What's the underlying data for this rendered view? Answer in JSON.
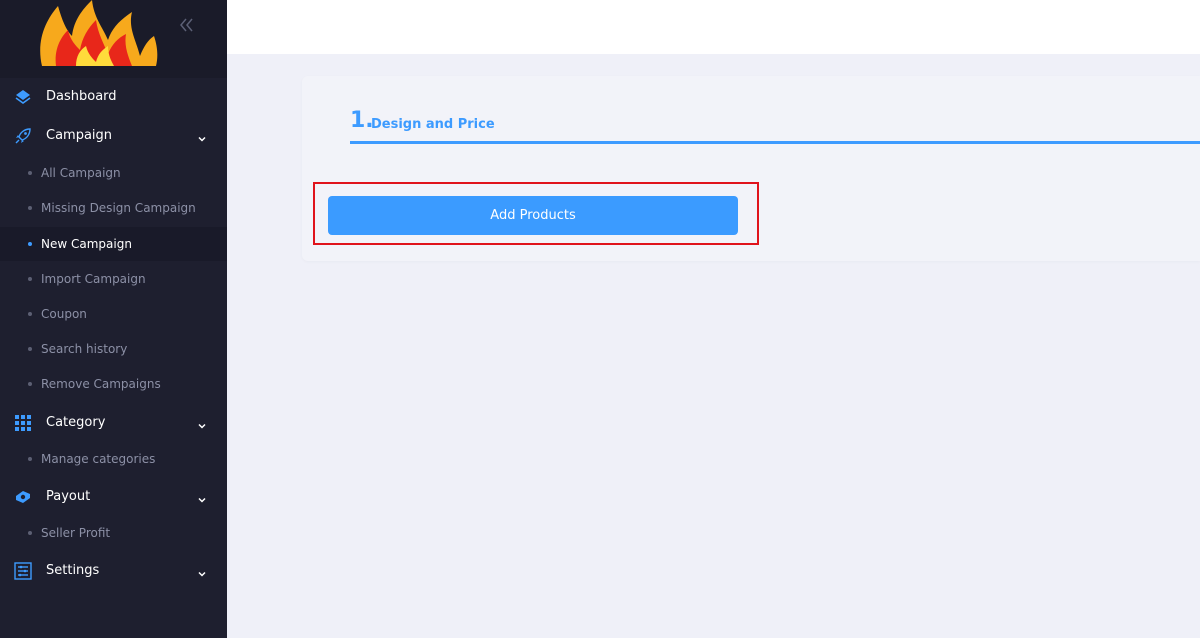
{
  "sidebar": {
    "items": [
      {
        "label": "Dashboard",
        "icon": "layers-icon"
      },
      {
        "label": "Campaign",
        "icon": "rocket-icon"
      },
      {
        "label": "Category",
        "icon": "grid-icon"
      },
      {
        "label": "Payout",
        "icon": "payout-icon"
      },
      {
        "label": "Settings",
        "icon": "settings-list-icon"
      }
    ],
    "campaign_sub": [
      {
        "label": "All Campaign"
      },
      {
        "label": "Missing Design Campaign"
      },
      {
        "label": "New Campaign",
        "active": true
      },
      {
        "label": "Import Campaign"
      },
      {
        "label": "Coupon"
      },
      {
        "label": "Search history"
      },
      {
        "label": "Remove Campaigns"
      }
    ],
    "category_sub": [
      {
        "label": "Manage categories"
      }
    ],
    "payout_sub": [
      {
        "label": "Seller Profit"
      }
    ]
  },
  "main": {
    "step": {
      "number": "1.",
      "title": "Design and Price"
    },
    "add_products_label": "Add Products"
  },
  "colors": {
    "accent": "#3d9bff",
    "sidebar_bg": "#1e1f2f",
    "highlight": "#e0131c"
  }
}
